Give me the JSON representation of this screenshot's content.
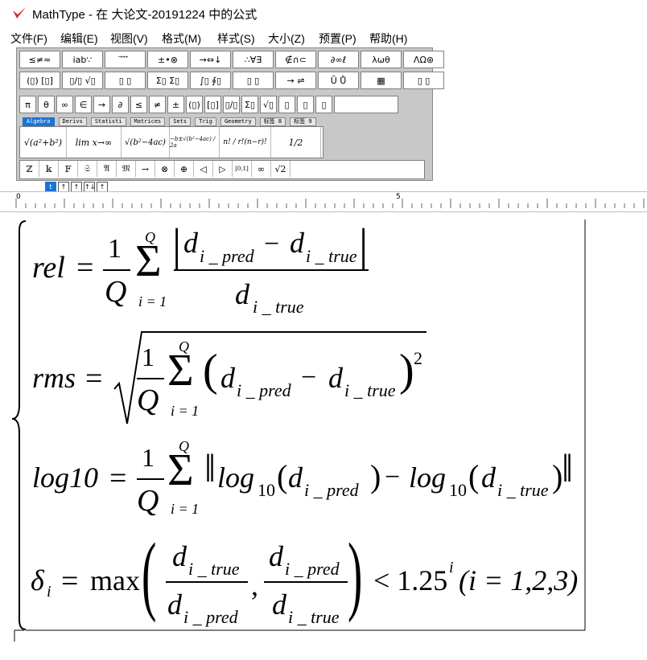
{
  "window": {
    "title": "MathType - 在 大论文-20191224 中的公式"
  },
  "menu": [
    "文件(F)",
    "编辑(E)",
    "视图(V)",
    "格式(M)",
    "样式(S)",
    "大小(Z)",
    "预置(P)",
    "帮助(H)"
  ],
  "palette_row1": [
    "≤≠≈",
    "ⅰab∵",
    "⃗ ⃗ ⃗",
    "±•⊗",
    "→⇔↓",
    "∴∀∃",
    "∉∩⊂",
    "∂∞ℓ",
    "λωθ",
    "ΛΩ⊛"
  ],
  "palette_row2": [
    "(▯) [▯]",
    "▯/▯ √▯",
    "▯ ▯",
    "Σ▯ Σ▯",
    "∫▯ ∮▯",
    "▯ ▯",
    "→ ⇌",
    "Ū Ů",
    "▦",
    "▯ ▯"
  ],
  "symbols": [
    "π",
    "θ",
    "∞",
    "∈",
    "→",
    "∂",
    "≤",
    "≠",
    "±",
    "(▯)",
    "[▯]",
    "▯/▯",
    "Σ▯",
    "√▯",
    "▯",
    "▯",
    "▯"
  ],
  "tabs": [
    "Algebra",
    "Derivs",
    "Statisti",
    "Matrices",
    "Sets",
    "Trig",
    "Geometry",
    "标签 8",
    "标签 9"
  ],
  "templates": [
    "√(a²+b²)",
    "lim x→∞",
    "√(b²−4ac)",
    "−b±√(b²−4ac) / 2a",
    "n! / r!(n−r)!",
    "1/2"
  ],
  "bottom_row": [
    "ℤ",
    "𝕜",
    "𝔽",
    "𝔖",
    "𝔄",
    "𝔐",
    "→",
    "⊗",
    "⊕",
    "◁",
    "▷",
    "[0,1]",
    "∞",
    "√2"
  ],
  "small_controls": [
    "t",
    "↑",
    "↑",
    "↑↓",
    "↑"
  ],
  "ruler": {
    "mark_0": "0",
    "mark_5": "5"
  },
  "equation": {
    "rel_lhs": "rel",
    "rms_lhs": "rms",
    "log_lhs": "log10",
    "delta": "δ",
    "delta_sub": "i",
    "one": "1",
    "Q": "Q",
    "sum_lower": "i = 1",
    "sum_upper": "Q",
    "d": "d",
    "sub_pred": "i _ pred",
    "sub_true": "i _ true",
    "log": "log",
    "log_base": "10",
    "power2": "2",
    "max": "max",
    "rhs": "< 1.25",
    "rhs_exp": "i",
    "condition": "(i = 1,2,3)"
  }
}
